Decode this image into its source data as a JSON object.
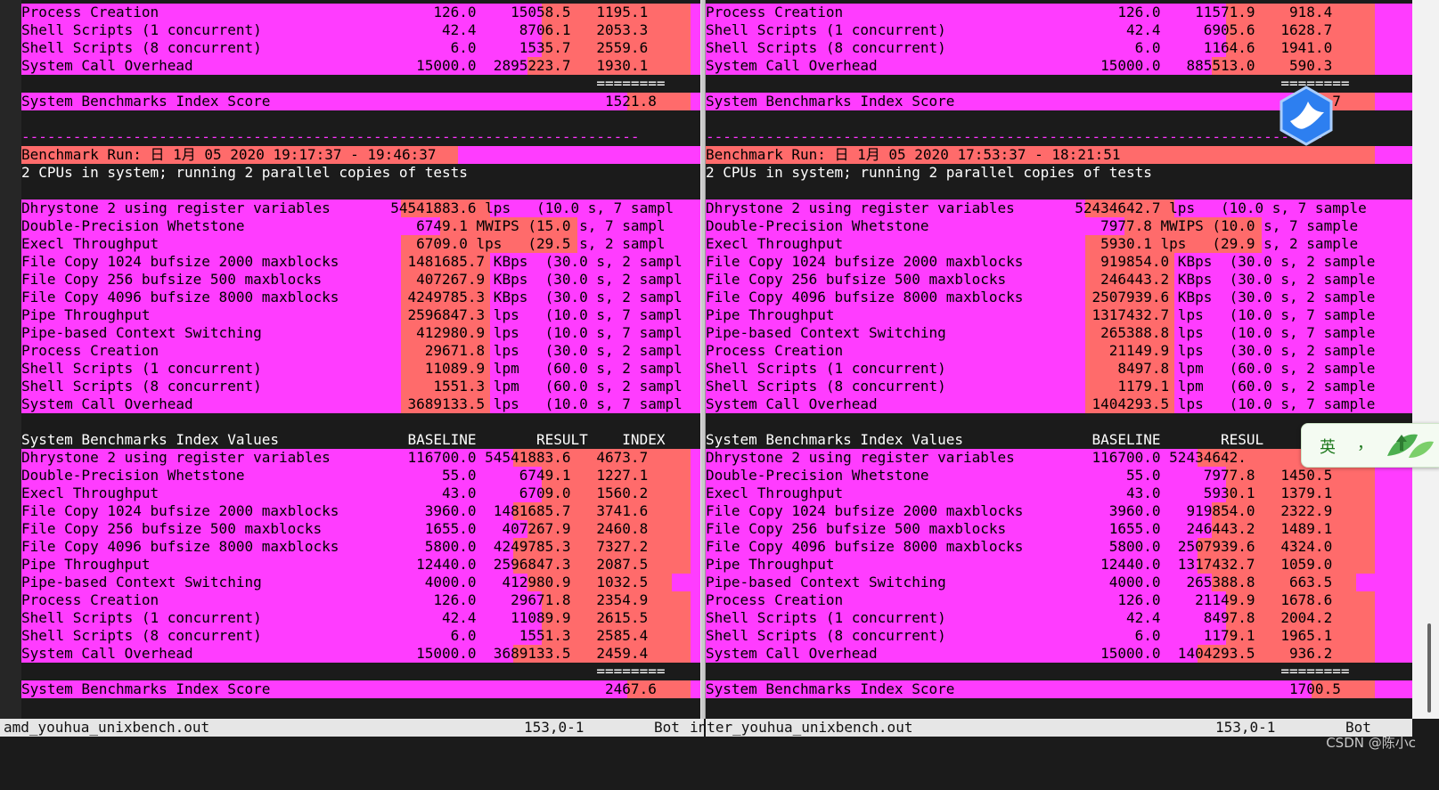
{
  "left": {
    "lines": [
      {
        "style": "m",
        "text": "Process Creation                                126.0    15058.5   1195.1",
        "hl": [
          [
            584,
            751
          ]
        ]
      },
      {
        "style": "m",
        "text": "Shell Scripts (1 concurrent)                     42.4     8706.1   2053.3",
        "hl": [
          [
            584,
            751
          ]
        ]
      },
      {
        "style": "m",
        "text": "Shell Scripts (8 concurrent)                      6.0     1535.7   2559.6",
        "hl": [
          [
            584,
            751
          ]
        ]
      },
      {
        "style": "m",
        "text": "System Call Overhead                          15000.0  2895223.7   1930.1",
        "hl": [
          [
            568,
            751
          ]
        ]
      },
      {
        "style": "w",
        "text": "                                                                   ========",
        "hl": []
      },
      {
        "style": "m",
        "text": "System Benchmarks Index Score                                       1521.8",
        "hl": [
          [
            680,
            751
          ]
        ]
      },
      {
        "style": "w",
        "text": "",
        "hl": []
      },
      {
        "style": "d",
        "text": "------------------------------------------------------------------------",
        "hl": []
      },
      {
        "style": "m",
        "text": "Benchmark Run: 日 1月 05 2020 19:17:37 - 19:46:37",
        "hl": [
          [
            0,
            490
          ]
        ]
      },
      {
        "style": "w",
        "text": "2 CPUs in system; running 2 parallel copies of tests",
        "hl": []
      },
      {
        "style": "w",
        "text": "",
        "hl": []
      },
      {
        "style": "m",
        "text": "Dhrystone 2 using register variables       54541883.6 lps   (10.0 s, 7 sampl",
        "hl": [
          [
            426,
            526
          ]
        ]
      },
      {
        "style": "m",
        "text": "Double-Precision Whetstone                    6749.1 MWIPS (15.0 s, 7 sampl",
        "hl": [
          [
            470,
            624
          ]
        ]
      },
      {
        "style": "m",
        "text": "Execl Throughput                              6709.0 lps   (29.5 s, 2 sampl",
        "hl": [
          [
            426,
            624
          ]
        ]
      },
      {
        "style": "m",
        "text": "File Copy 1024 bufsize 2000 maxblocks        1481685.7 KBps  (30.0 s, 2 sampl",
        "hl": [
          [
            426,
            526
          ]
        ]
      },
      {
        "style": "m",
        "text": "File Copy 256 bufsize 500 maxblocks           407267.9 KBps  (30.0 s, 2 sampl",
        "hl": [
          [
            426,
            526
          ]
        ]
      },
      {
        "style": "m",
        "text": "File Copy 4096 bufsize 8000 maxblocks        4249785.3 KBps  (30.0 s, 2 sampl",
        "hl": [
          [
            426,
            526
          ]
        ]
      },
      {
        "style": "m",
        "text": "Pipe Throughput                              2596847.3 lps   (10.0 s, 7 sampl",
        "hl": [
          [
            426,
            526
          ]
        ]
      },
      {
        "style": "m",
        "text": "Pipe-based Context Switching                  412980.9 lps   (10.0 s, 7 sampl",
        "hl": [
          [
            426,
            526
          ]
        ]
      },
      {
        "style": "m",
        "text": "Process Creation                               29671.8 lps   (30.0 s, 2 sampl",
        "hl": [
          [
            426,
            526
          ]
        ]
      },
      {
        "style": "m",
        "text": "Shell Scripts (1 concurrent)                   11089.9 lpm   (60.0 s, 2 sampl",
        "hl": [
          [
            426,
            526
          ]
        ]
      },
      {
        "style": "m",
        "text": "Shell Scripts (8 concurrent)                    1551.3 lpm   (60.0 s, 2 sampl",
        "hl": [
          [
            426,
            526
          ]
        ]
      },
      {
        "style": "m",
        "text": "System Call Overhead                         3689133.5 lps   (10.0 s, 7 sampl",
        "hl": [
          [
            426,
            526
          ]
        ]
      },
      {
        "style": "w",
        "text": "",
        "hl": []
      },
      {
        "style": "w",
        "text": "System Benchmarks Index Values               BASELINE       RESULT    INDEX",
        "hl": []
      },
      {
        "style": "m",
        "text": "Dhrystone 2 using register variables         116700.0 54541883.6   4673.7",
        "hl": [
          [
            552,
            751
          ]
        ]
      },
      {
        "style": "m",
        "text": "Double-Precision Whetstone                       55.0     6749.1   1227.1",
        "hl": [
          [
            584,
            751
          ]
        ]
      },
      {
        "style": "m",
        "text": "Execl Throughput                                 43.0     6709.0   1560.2",
        "hl": [
          [
            584,
            751
          ]
        ]
      },
      {
        "style": "m",
        "text": "File Copy 1024 bufsize 2000 maxblocks          3960.0  1481685.7   3741.6",
        "hl": [
          [
            552,
            751
          ]
        ]
      },
      {
        "style": "m",
        "text": "File Copy 256 bufsize 500 maxblocks            1655.0   407267.9   2460.8",
        "hl": [
          [
            568,
            751
          ]
        ]
      },
      {
        "style": "m",
        "text": "File Copy 4096 bufsize 8000 maxblocks          5800.0  4249785.3   7327.2",
        "hl": [
          [
            552,
            751
          ]
        ]
      },
      {
        "style": "m",
        "text": "Pipe Throughput                               12440.0  2596847.3   2087.5",
        "hl": [
          [
            552,
            751
          ]
        ]
      },
      {
        "style": "m",
        "text": "Pipe-based Context Switching                   4000.0   412980.9   1032.5",
        "hl": [
          [
            568,
            730
          ]
        ]
      },
      {
        "style": "m",
        "text": "Process Creation                                126.0    29671.8   2354.9",
        "hl": [
          [
            584,
            751
          ]
        ]
      },
      {
        "style": "m",
        "text": "Shell Scripts (1 concurrent)                     42.4    11089.9   2615.5",
        "hl": [
          [
            584,
            751
          ]
        ]
      },
      {
        "style": "m",
        "text": "Shell Scripts (8 concurrent)                      6.0     1551.3   2585.4",
        "hl": [
          [
            584,
            751
          ]
        ]
      },
      {
        "style": "m",
        "text": "System Call Overhead                          15000.0  3689133.5   2459.4",
        "hl": [
          [
            552,
            751
          ]
        ]
      },
      {
        "style": "w",
        "text": "                                                                   ========",
        "hl": []
      },
      {
        "style": "m",
        "text": "System Benchmarks Index Score                                       2467.6",
        "hl": [
          [
            680,
            751
          ]
        ]
      }
    ],
    "status": {
      "file": "amd_youhua_unixbench.out",
      "pos": "153,0-1",
      "where": "Bot"
    }
  },
  "right": {
    "lines": [
      {
        "style": "m",
        "text": "Process Creation                                126.0    11571.9    918.4",
        "hl": [
          [
            584,
            751
          ]
        ]
      },
      {
        "style": "m",
        "text": "Shell Scripts (1 concurrent)                     42.4     6905.6   1628.7",
        "hl": [
          [
            584,
            751
          ]
        ]
      },
      {
        "style": "m",
        "text": "Shell Scripts (8 concurrent)                      6.0     1164.6   1941.0",
        "hl": [
          [
            584,
            751
          ]
        ]
      },
      {
        "style": "m",
        "text": "System Call Overhead                          15000.0   885513.0    590.3",
        "hl": [
          [
            568,
            751
          ]
        ]
      },
      {
        "style": "w",
        "text": "                                                                   ========",
        "hl": []
      },
      {
        "style": "m",
        "text": "System Benchmarks Index Score                                       1050.7",
        "hl": [
          [
            680,
            751
          ]
        ]
      },
      {
        "style": "w",
        "text": "",
        "hl": []
      },
      {
        "style": "d",
        "text": "------------------------------------------------------------------------",
        "hl": []
      },
      {
        "style": "m",
        "text": "Benchmark Run: 日 1月 05 2020 17:53:37 - 18:21:51",
        "hl": [
          [
            0,
            751
          ]
        ]
      },
      {
        "style": "w",
        "text": "2 CPUs in system; running 2 parallel copies of tests",
        "hl": []
      },
      {
        "style": "w",
        "text": "",
        "hl": []
      },
      {
        "style": "m",
        "text": "Dhrystone 2 using register variables       52434642.7 lps   (10.0 s, 7 sample",
        "hl": [
          [
            426,
            526
          ]
        ]
      },
      {
        "style": "m",
        "text": "Double-Precision Whetstone                    7977.8 MWIPS (10.0 s, 7 sample",
        "hl": [
          [
            470,
            624
          ]
        ]
      },
      {
        "style": "m",
        "text": "Execl Throughput                              5930.1 lps   (29.9 s, 2 sample",
        "hl": [
          [
            426,
            624
          ]
        ]
      },
      {
        "style": "m",
        "text": "File Copy 1024 bufsize 2000 maxblocks         919854.0 KBps  (30.0 s, 2 sample",
        "hl": [
          [
            426,
            526
          ]
        ]
      },
      {
        "style": "m",
        "text": "File Copy 256 bufsize 500 maxblocks           246443.2 KBps  (30.0 s, 2 sample",
        "hl": [
          [
            426,
            526
          ]
        ]
      },
      {
        "style": "m",
        "text": "File Copy 4096 bufsize 8000 maxblocks        2507939.6 KBps  (30.0 s, 2 sample",
        "hl": [
          [
            426,
            526
          ]
        ]
      },
      {
        "style": "m",
        "text": "Pipe Throughput                              1317432.7 lps   (10.0 s, 7 sample",
        "hl": [
          [
            426,
            526
          ]
        ]
      },
      {
        "style": "m",
        "text": "Pipe-based Context Switching                  265388.8 lps   (10.0 s, 7 sample",
        "hl": [
          [
            426,
            526
          ]
        ]
      },
      {
        "style": "m",
        "text": "Process Creation                               21149.9 lps   (30.0 s, 2 sample",
        "hl": [
          [
            426,
            526
          ]
        ]
      },
      {
        "style": "m",
        "text": "Shell Scripts (1 concurrent)                    8497.8 lpm   (60.0 s, 2 sample",
        "hl": [
          [
            426,
            526
          ]
        ]
      },
      {
        "style": "m",
        "text": "Shell Scripts (8 concurrent)                    1179.1 lpm   (60.0 s, 2 sample",
        "hl": [
          [
            426,
            526
          ]
        ]
      },
      {
        "style": "m",
        "text": "System Call Overhead                         1404293.5 lps   (10.0 s, 7 sample",
        "hl": [
          [
            426,
            526
          ]
        ]
      },
      {
        "style": "w",
        "text": "",
        "hl": []
      },
      {
        "style": "w",
        "text": "System Benchmarks Index Values               BASELINE       RESUL",
        "hl": []
      },
      {
        "style": "m",
        "text": "Dhrystone 2 using register variables         116700.0 52434642.",
        "hl": [
          [
            552,
            751
          ]
        ]
      },
      {
        "style": "m",
        "text": "Double-Precision Whetstone                       55.0     7977.8   1450.5",
        "hl": [
          [
            584,
            751
          ]
        ]
      },
      {
        "style": "m",
        "text": "Execl Throughput                                 43.0     5930.1   1379.1",
        "hl": [
          [
            584,
            751
          ]
        ]
      },
      {
        "style": "m",
        "text": "File Copy 1024 bufsize 2000 maxblocks          3960.0   919854.0   2322.9",
        "hl": [
          [
            568,
            751
          ]
        ]
      },
      {
        "style": "m",
        "text": "File Copy 256 bufsize 500 maxblocks            1655.0   246443.2   1489.1",
        "hl": [
          [
            568,
            751
          ]
        ]
      },
      {
        "style": "m",
        "text": "File Copy 4096 bufsize 8000 maxblocks          5800.0  2507939.6   4324.0",
        "hl": [
          [
            552,
            751
          ]
        ]
      },
      {
        "style": "m",
        "text": "Pipe Throughput                               12440.0  1317432.7   1059.0",
        "hl": [
          [
            552,
            751
          ]
        ]
      },
      {
        "style": "m",
        "text": "Pipe-based Context Switching                   4000.0   265388.8    663.5",
        "hl": [
          [
            568,
            730
          ]
        ]
      },
      {
        "style": "m",
        "text": "Process Creation                                126.0    21149.9   1678.6",
        "hl": [
          [
            584,
            751
          ]
        ]
      },
      {
        "style": "m",
        "text": "Shell Scripts (1 concurrent)                     42.4     8497.8   2004.2",
        "hl": [
          [
            584,
            751
          ]
        ]
      },
      {
        "style": "m",
        "text": "Shell Scripts (8 concurrent)                      6.0     1179.1   1965.1",
        "hl": [
          [
            584,
            751
          ]
        ]
      },
      {
        "style": "m",
        "text": "System Call Overhead                          15000.0  1404293.5    936.2",
        "hl": [
          [
            552,
            751
          ]
        ]
      },
      {
        "style": "w",
        "text": "                                                                   ========",
        "hl": []
      },
      {
        "style": "m",
        "text": "System Benchmarks Index Score                                       1700.5",
        "hl": [
          [
            680,
            751
          ]
        ]
      }
    ],
    "status": {
      "file": "inter_youhua_unixbench.out",
      "pos": "153,0-1",
      "where": "Bot"
    }
  },
  "ime": {
    "mode_char": "英",
    "punct": "，"
  },
  "watermark": "CSDN @陈小c",
  "colors": {
    "highlight_magenta": "#ff3cff",
    "highlight_red": "#ff6b6b",
    "terminal_bg": "#1b1b1b",
    "status_bg": "#e6e6e6"
  }
}
